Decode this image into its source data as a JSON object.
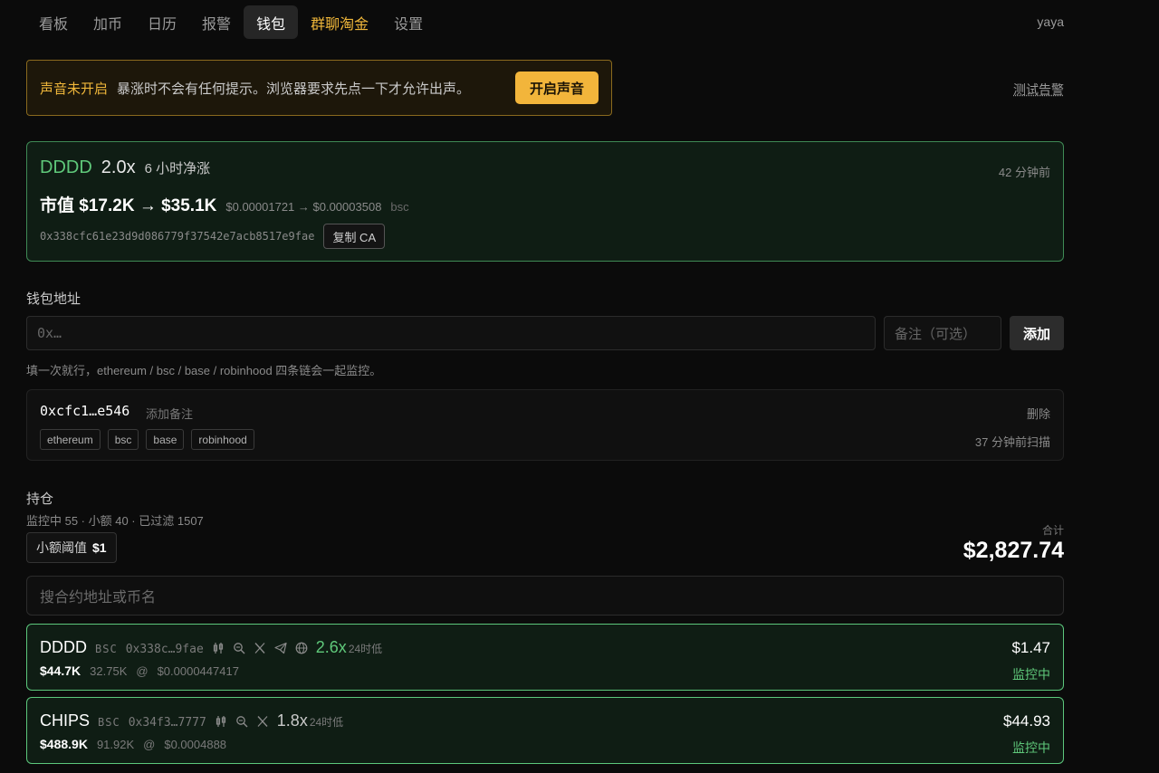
{
  "nav": {
    "items": [
      "看板",
      "加币",
      "日历",
      "报警",
      "钱包",
      "群聊淘金",
      "设置"
    ],
    "user": "yaya"
  },
  "banner": {
    "title": "声音未开启",
    "text": "暴涨时不会有任何提示。浏览器要求先点一下才允许出声。",
    "button": "开启声音",
    "test_link": "测试告警"
  },
  "alert": {
    "symbol": "DDDD",
    "multiple": "2.0x",
    "desc": "6 小时净涨",
    "time": "42 分钟前",
    "mcap": "市值 $17.2K → $35.1K",
    "price": "$0.00001721 → $0.00003508",
    "chain": "bsc",
    "ca": "0x338cfc61e23d9d086779f37542e7acb8517e9fae",
    "copy_button": "复制 CA"
  },
  "wallet": {
    "title": "钱包地址",
    "address_placeholder": "0x…",
    "note_placeholder": "备注（可选）",
    "add_button": "添加",
    "hint": "填一次就行，ethereum / bsc / base / robinhood 四条链会一起监控。",
    "card": {
      "address": "0xcfc1…e546",
      "add_note": "添加备注",
      "delete": "删除",
      "tags": [
        "ethereum",
        "bsc",
        "base",
        "robinhood"
      ],
      "scan": "37 分钟前扫描"
    }
  },
  "holdings": {
    "title": "持仓",
    "summary": "监控中 55 · 小额 40 · 已过滤 1507",
    "threshold_label": "小额阈值",
    "threshold_value": "$1",
    "total_label": "合计",
    "total_value": "$2,827.74",
    "search_placeholder": "搜合约地址或币名",
    "items": [
      {
        "symbol": "DDDD",
        "chain": "BSC",
        "ca": "0x338c…9fae",
        "multiple": "2.6x",
        "multiple_color": "#5fc87a",
        "multiple_sub": "24时低",
        "value": "$1.47",
        "mcap": "$44.7K",
        "amount": "32.75K",
        "at": "@",
        "price": "$0.0000447417",
        "status": "监控中",
        "icons": [
          "candlestick-icon",
          "search-zoom-icon",
          "x-twitter-icon",
          "telegram-icon",
          "globe-icon"
        ]
      },
      {
        "symbol": "CHIPS",
        "chain": "BSC",
        "ca": "0x34f3…7777",
        "multiple": "1.8x",
        "multiple_color": "#c9c9c9",
        "multiple_sub": "24时低",
        "value": "$44.93",
        "mcap": "$488.9K",
        "amount": "91.92K",
        "at": "@",
        "price": "$0.0004888",
        "status": "监控中",
        "icons": [
          "candlestick-icon",
          "search-zoom-icon",
          "x-twitter-icon"
        ]
      }
    ]
  },
  "colors": {
    "accent_gold": "#f0b73a",
    "accent_green": "#5fc87a",
    "background": "#0b0b0b"
  }
}
